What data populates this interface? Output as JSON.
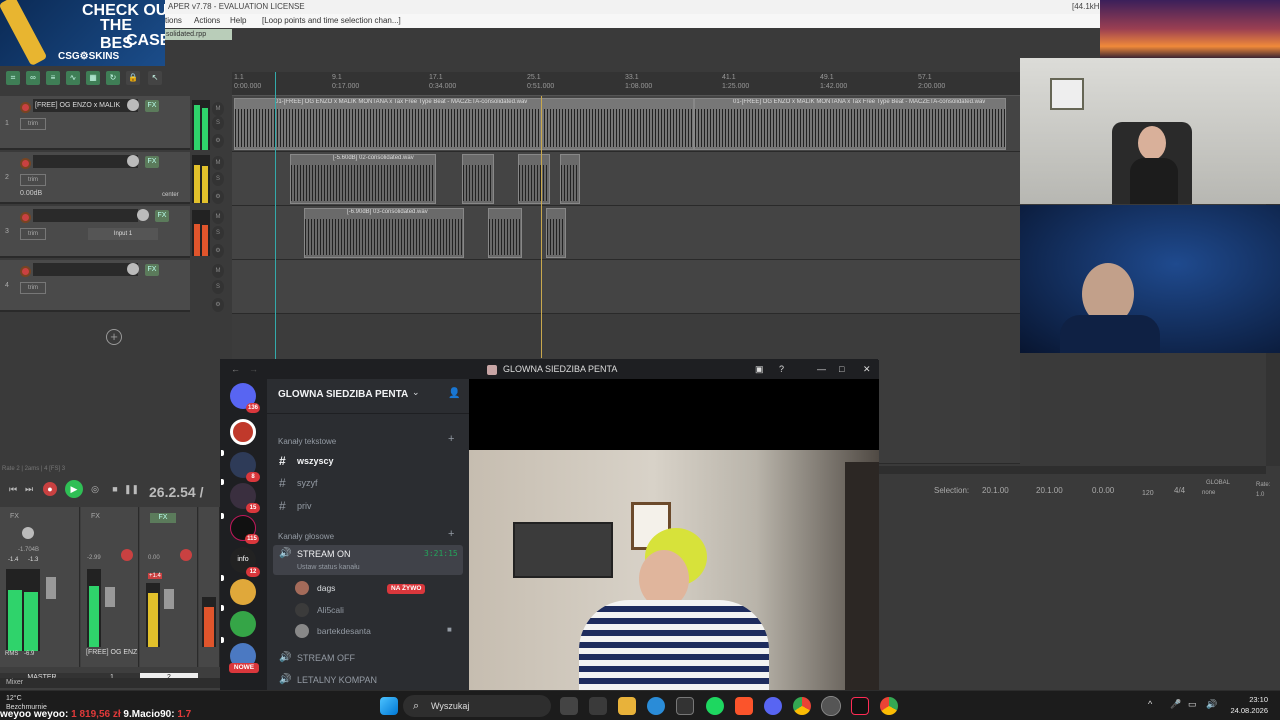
{
  "window": {
    "title": "APER v7.78 - EVALUATION LICENSE",
    "rate": "[44.1kH"
  },
  "menu": [
    "tions",
    "Actions",
    "Help",
    "[Loop points and time selection chan...]"
  ],
  "project_tab": "solidated.rpp",
  "ad": {
    "line1": "CHECK OU",
    "line2": "THE BES",
    "line3": "CASE",
    "brand": "CSG⚙SKINS"
  },
  "ruler": {
    "marks": [
      "1.1",
      "9.1",
      "17.1",
      "25.1",
      "33.1",
      "41.1",
      "49.1",
      "57.1"
    ],
    "times": [
      "0:00.000",
      "0:17.000",
      "0:34.000",
      "0:51.000",
      "1:08.000",
      "1:25.000",
      "1:42.000",
      "2:00.000"
    ]
  },
  "tracks": [
    {
      "num": "1",
      "name": "[FREE] OG ENZO x MALIK",
      "fx": "FX",
      "trim": "trim"
    },
    {
      "num": "2",
      "name": "",
      "fx": "FX",
      "trim": "trim",
      "vol": "0.00dB",
      "pan": "center"
    },
    {
      "num": "3",
      "name": "",
      "fx": "FX",
      "trim": "trim",
      "input": "Input 1"
    },
    {
      "num": "4",
      "name": "",
      "fx": "FX",
      "trim": "trim"
    }
  ],
  "items": {
    "t1a": "01-[FREE] OG ENZO x MALIK MONTANA x Tax Free Type Beat - MACZETA-consolidated.wav",
    "t1b": "01-[FREE] OG ENZO x MALIK MONTANA x Tax Free Type Beat - MACZETA-consolidated.wav",
    "t2": "[-5.60dB] 02-consolidated.wav",
    "t3": "[-6.90dB] 03-consolidated.wav"
  },
  "transport": {
    "time": "26.2.54 /",
    "status": "Rate 2 | 2ams | 4 [FS] 3"
  },
  "selection": {
    "label": "Selection:",
    "start": "20.1.00",
    "end": "20.1.00",
    "length": "0.0.00",
    "bpm": "120",
    "sig": "4/4",
    "global": "GLOBAL",
    "none": "none",
    "rate": "Rate:",
    "rate_val": "1.0"
  },
  "mixer": {
    "label": "Mixer",
    "master": "MASTER",
    "strip1": "1",
    "strip2": "2",
    "track_label": "[FREE] OG ENZ",
    "rms": "RMS",
    "rms_val": "-6.9",
    "m1": "-1.4",
    "m2": "-1.3",
    "m3": "-1.704B",
    "v1": "-2.99",
    "v2": "0.00",
    "v3": "+1.4"
  },
  "discord": {
    "window_title": "GLOWNA SIEDZIBA PENTA",
    "guild": "GLOWNA SIEDZIBA PENTA",
    "servers": [
      {
        "badge": "136"
      },
      {
        "badge": ""
      },
      {
        "badge": "8"
      },
      {
        "badge": "15"
      },
      {
        "badge": "115"
      },
      {
        "badge": "12",
        "label": "info"
      },
      {
        "badge": ""
      },
      {
        "badge": ""
      },
      {
        "badge": "NOWE"
      }
    ],
    "text_category": "Kanały tekstowe",
    "text_channels": [
      "wszyscy",
      "syzyf",
      "priv"
    ],
    "voice_category": "Kanały głosowe",
    "voice_active": {
      "name": "STREAM ON",
      "time": "3:21:15",
      "status": "Ustaw status kanału"
    },
    "members": [
      {
        "name": "dags",
        "badge": "NA ŻYWO"
      },
      {
        "name": "Ali5cali"
      },
      {
        "name": "bartekdesanta"
      }
    ],
    "voice_other": [
      "STREAM OFF",
      "LETALNY KOMPAN"
    ]
  },
  "taskbar": {
    "search": "Wyszukaj",
    "time": "23:10",
    "date": "24.08.2026",
    "weather_temp": "12°C",
    "weather_desc": "Bezchmurnie"
  },
  "ticker": [
    {
      "text": "weyoo weyoo:",
      "color": "#ffffff"
    },
    {
      "text": " 1 819,56 zł ",
      "color": "#e23a3a"
    },
    {
      "text": "9.Macio90:",
      "color": "#ffffff"
    },
    {
      "text": " 1.7",
      "color": "#e23a3a"
    }
  ],
  "colors": {
    "reaper_bg": "#3a3a3a",
    "discord_bg": "#313338",
    "red": "#da373c",
    "green": "#23a55a",
    "waveform": "#222222"
  }
}
